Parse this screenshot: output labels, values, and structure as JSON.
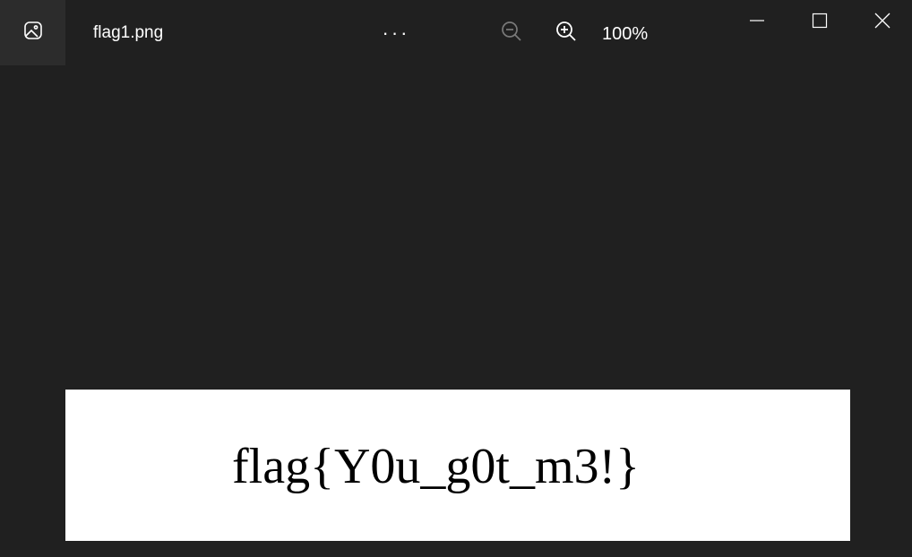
{
  "window": {
    "file_name": "flag1.png",
    "more_label": "···",
    "zoom_level": "100%",
    "icons": {
      "app": "photo-icon",
      "zoom_out": "zoom-out-icon",
      "zoom_in": "zoom-in-icon",
      "minimize": "minimize-icon",
      "maximize": "maximize-icon",
      "close": "close-icon"
    }
  },
  "image": {
    "text": "flag{Y0u_g0t_m3!}"
  },
  "colors": {
    "background": "#202020",
    "app_icon_bg": "#2c2c2c",
    "canvas": "#ffffff",
    "disabled_icon": "#7a7a7a"
  }
}
